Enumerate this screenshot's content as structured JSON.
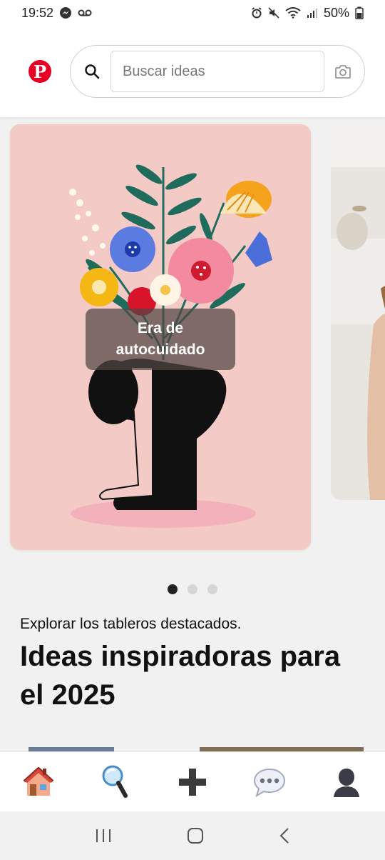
{
  "status_bar": {
    "time": "19:52",
    "battery": "50%"
  },
  "header": {
    "logo_letter": "P",
    "search": {
      "placeholder": "Buscar ideas",
      "value": ""
    }
  },
  "carousel": {
    "cards": [
      {
        "title": "Era de autocuidado"
      }
    ],
    "dots": {
      "count": 3,
      "active_index": 0
    }
  },
  "section": {
    "subtitle": "Explorar los tableros destacados.",
    "title": "Ideas inspiradoras para el 2025"
  },
  "bottom_nav": {
    "items": [
      {
        "icon": "home-icon"
      },
      {
        "icon": "search-icon"
      },
      {
        "icon": "plus-icon"
      },
      {
        "icon": "messages-icon"
      },
      {
        "icon": "profile-icon"
      }
    ]
  },
  "system_nav": {
    "icons": [
      "recent-apps-icon",
      "home-button-icon",
      "back-icon"
    ]
  },
  "colors": {
    "brand": "#e60023",
    "card_bg": "#f4cac6",
    "overlay": "#50463f"
  }
}
